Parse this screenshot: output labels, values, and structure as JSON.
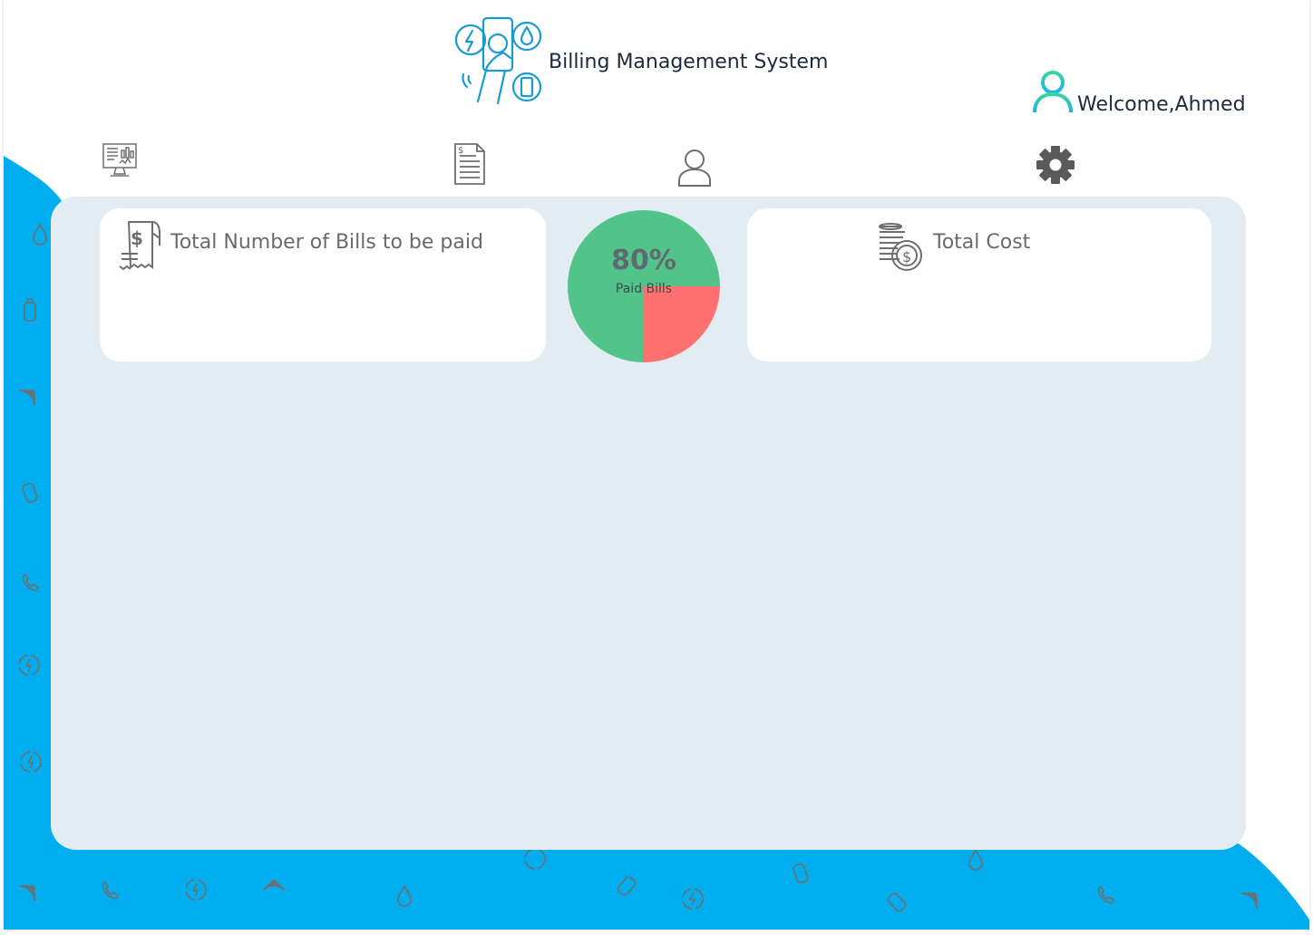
{
  "header": {
    "app_title": "Billing Management System",
    "welcome_text": "Welcome,Ahmed"
  },
  "nav": [
    {
      "icon": "dashboard-monitor-icon"
    },
    {
      "icon": "invoice-document-icon"
    },
    {
      "icon": "user-profile-icon"
    },
    {
      "icon": "settings-gear-icon"
    }
  ],
  "cards": {
    "bills": {
      "label": "Total Number of  Bills to be paid",
      "icon": "receipt-dollar-icon"
    },
    "cost": {
      "label": "Total Cost",
      "icon": "coins-stack-icon"
    }
  },
  "paid_chart": {
    "percent_text": "80%",
    "caption": "Paid Bills"
  },
  "chart_data": {
    "type": "pie",
    "title": "",
    "slices": [
      {
        "label": "",
        "value": 75,
        "color": "#52c48a"
      },
      {
        "label": "",
        "value": 25,
        "color": "#ff7170"
      }
    ]
  },
  "colors": {
    "accent_blue": "#00aeef",
    "panel": "#e3ecf2",
    "card": "#ffffff",
    "paid_green": "#52c48a",
    "unpaid_red": "#ff7170",
    "user_icon_gradient": [
      "#36d6a0",
      "#1ab4e8"
    ]
  }
}
